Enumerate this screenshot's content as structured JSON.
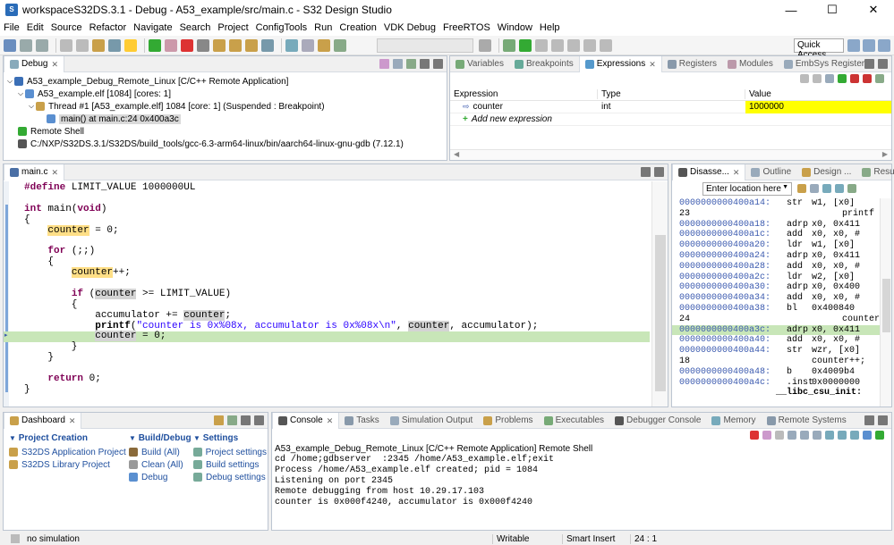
{
  "window": {
    "title": "workspaceS32DS.3.1 - Debug - A53_example/src/main.c - S32 Design Studio"
  },
  "menu": [
    "File",
    "Edit",
    "Source",
    "Refactor",
    "Navigate",
    "Search",
    "Project",
    "ConfigTools",
    "Run",
    "Creation",
    "VDK Debug",
    "FreeRTOS",
    "Window",
    "Help"
  ],
  "toolbar": {
    "quick_access": "Quick Access"
  },
  "debug": {
    "tab": "Debug",
    "items": [
      "A53_example_Debug_Remote_Linux [C/C++ Remote Application]",
      "A53_example.elf [1084] [cores: 1]",
      "Thread #1 [A53_example.elf] 1084 [core: 1] (Suspended : Breakpoint)",
      "main() at main.c:24 0x400a3c",
      "Remote Shell",
      "C:/NXP/S32DS.3.1/S32DS/build_tools/gcc-6.3-arm64-linux/bin/aarch64-linux-gnu-gdb (7.12.1)"
    ]
  },
  "variables": {
    "tabs": [
      "Variables",
      "Breakpoints",
      "Expressions",
      "Registers",
      "Modules",
      "EmbSys Registers"
    ],
    "columns": [
      "Expression",
      "Type",
      "Value"
    ],
    "rows": [
      {
        "expr": "counter",
        "type": "int",
        "value": "1000000"
      }
    ],
    "add_label": "Add new expression"
  },
  "editor": {
    "tab": "main.c",
    "lines": [
      {
        "t": "define",
        "a": "#define",
        "b": " LIMIT_VALUE 1000000UL"
      },
      {
        "t": "blank"
      },
      {
        "t": "kw",
        "a": "int",
        "b": " main(",
        "c": "void",
        ")": ")"
      },
      {
        "t": "plain",
        "a": "{"
      },
      {
        "t": "plain",
        "a": "    counter = 0;"
      },
      {
        "t": "blank"
      },
      {
        "t": "plain",
        "a": "    for (;;)"
      },
      {
        "t": "plain",
        "a": "    {"
      },
      {
        "t": "plain",
        "a": "        counter++;"
      },
      {
        "t": "blank"
      },
      {
        "t": "plain",
        "a": "        if (counter >= LIMIT_VALUE)"
      },
      {
        "t": "plain",
        "a": "        {"
      },
      {
        "t": "plain",
        "a": "            accumulator += counter;"
      },
      {
        "t": "plain",
        "a": "            printf(\"counter is 0x%08x, accumulator is 0x%08x\\n\", counter, accumulator);"
      },
      {
        "t": "plain",
        "a": "            counter = 0;"
      },
      {
        "t": "plain",
        "a": "        }"
      },
      {
        "t": "plain",
        "a": "    }"
      },
      {
        "t": "blank"
      },
      {
        "t": "plain",
        "a": "    return 0;"
      },
      {
        "t": "plain",
        "a": "}"
      }
    ]
  },
  "disassembly": {
    "tabs": [
      "Disasse...",
      "Outline",
      "Design ...",
      "Results"
    ],
    "location_placeholder": "Enter location here",
    "lines": [
      {
        "addr": "0000000000400a14:",
        "op": "str",
        "args": "w1, [x0]"
      },
      {
        "addr": "",
        "op": "",
        "args": "printf",
        "src": "23"
      },
      {
        "addr": "0000000000400a18:",
        "op": "adrp",
        "args": "x0, 0x411"
      },
      {
        "addr": "0000000000400a1c:",
        "op": "add",
        "args": "x0, x0, #"
      },
      {
        "addr": "0000000000400a20:",
        "op": "ldr",
        "args": "w1, [x0]"
      },
      {
        "addr": "0000000000400a24:",
        "op": "adrp",
        "args": "x0, 0x411"
      },
      {
        "addr": "0000000000400a28:",
        "op": "add",
        "args": "x0, x0, #"
      },
      {
        "addr": "0000000000400a2c:",
        "op": "ldr",
        "args": "w2, [x0]"
      },
      {
        "addr": "0000000000400a30:",
        "op": "adrp",
        "args": "x0, 0x400"
      },
      {
        "addr": "0000000000400a34:",
        "op": "add",
        "args": "x0, x0, #"
      },
      {
        "addr": "0000000000400a38:",
        "op": "bl",
        "args": "0x400840"
      },
      {
        "addr": "",
        "op": "",
        "args": "counter",
        "src": "24"
      },
      {
        "addr": "0000000000400a3c:",
        "op": "adrp",
        "args": "x0, 0x411"
      },
      {
        "addr": "0000000000400a40:",
        "op": "add",
        "args": "x0, x0, #"
      },
      {
        "addr": "0000000000400a44:",
        "op": "str",
        "args": "wzr, [x0]"
      },
      {
        "addr": "",
        "op": "",
        "args": "counter++;",
        "src": "18"
      },
      {
        "addr": "0000000000400a48:",
        "op": "b",
        "args": "0x4009b4"
      },
      {
        "addr": "0000000000400a4c:",
        "op": ".inst",
        "args": "0x0000000"
      },
      {
        "addr": "",
        "op": "",
        "args": "__libc_csu_init:",
        "src": ""
      }
    ]
  },
  "dashboard": {
    "tab": "Dashboard",
    "sections": [
      {
        "title": "Project Creation",
        "items": [
          "S32DS Application Project",
          "S32DS Library Project"
        ]
      },
      {
        "title": "Build/Debug",
        "items": [
          "Build  (All)",
          "Clean  (All)",
          "Debug"
        ]
      },
      {
        "title": "Settings",
        "items": [
          "Project settings",
          "Build settings",
          "Debug settings"
        ]
      }
    ]
  },
  "console": {
    "tabs": [
      "Console",
      "Tasks",
      "Simulation Output",
      "Problems",
      "Executables",
      "Debugger Console",
      "Memory",
      "Remote Systems"
    ],
    "header": "A53_example_Debug_Remote_Linux [C/C++ Remote Application] Remote Shell",
    "lines": [
      "cd /home;gdbserver  :2345 /home/A53_example.elf;exit",
      "Process /home/A53_example.elf created; pid = 1084",
      "Listening on port 2345",
      "Remote debugging from host 10.29.17.103",
      "counter is 0x000f4240, accumulator is 0x000f4240"
    ]
  },
  "status": {
    "left": "no simulation",
    "mode": "Writable",
    "insert": "Smart Insert",
    "pos": "24 : 1"
  }
}
